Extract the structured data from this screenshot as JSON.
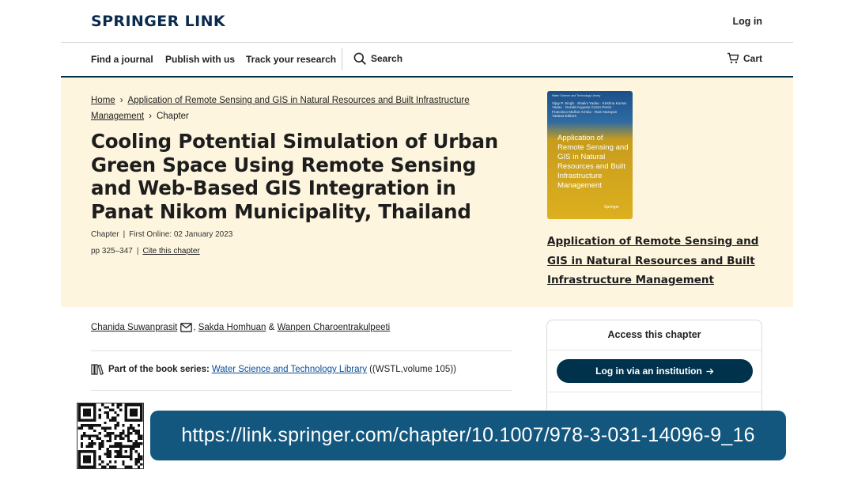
{
  "header": {
    "logo": "SPRINGER LINK",
    "login": "Log in"
  },
  "nav": {
    "items": [
      "Find a journal",
      "Publish with us",
      "Track your research"
    ],
    "search": "Search",
    "cart": "Cart"
  },
  "breadcrumb": {
    "home": "Home",
    "book_line1": "Application of Remote Sensing and GIS in Natural Resources and Built Infrastructure",
    "book_line2": "Management",
    "current": "Chapter"
  },
  "article": {
    "title": "Cooling Potential Simulation of Urban Green Space Using Remote Sensing and Web-Based GIS Integration in Panat Nikom Municipality, Thailand",
    "type": "Chapter",
    "first_online": "First Online: 02 January 2023",
    "pages": "pp 325–347",
    "cite": "Cite this chapter"
  },
  "book": {
    "cover_series": "Water Science and Technology Library",
    "cover_editors": "Vijay P. Singh · Shalini Yadav · Krishna Kumar Yadav · Gerald Augusto Corzo Perez · Francisco Muñoz-Arriola · Ram Narayan Yadava   Editors",
    "cover_title": "Application of Remote Sensing and GIS in Natural Resources and Built Infrastructure Management",
    "cover_publisher": "Springer",
    "title": "Application of Remote Sensing and GIS in Natural Resources and Built Infrastructure Management"
  },
  "authors": {
    "a1": "Chanida Suwanprasit",
    "a2": "Sakda Homhuan",
    "amp": "&",
    "a3": "Wanpen Charoentrakulpeeti"
  },
  "series": {
    "label": "Part of the book series:",
    "name": "Water Science and Technology Library",
    "volume": "((WSTL,volume 105))"
  },
  "access": {
    "heading": "Access this chapter",
    "button": "Log in via an institution"
  },
  "banner": {
    "url": "https://link.springer.com/chapter/10.1007/978-3-031-14096-9_16"
  },
  "colors": {
    "brand_navy": "#01324b",
    "hero_bg": "#fdf5de",
    "banner_blue": "#13577f",
    "link_blue": "#0a4c9a"
  }
}
